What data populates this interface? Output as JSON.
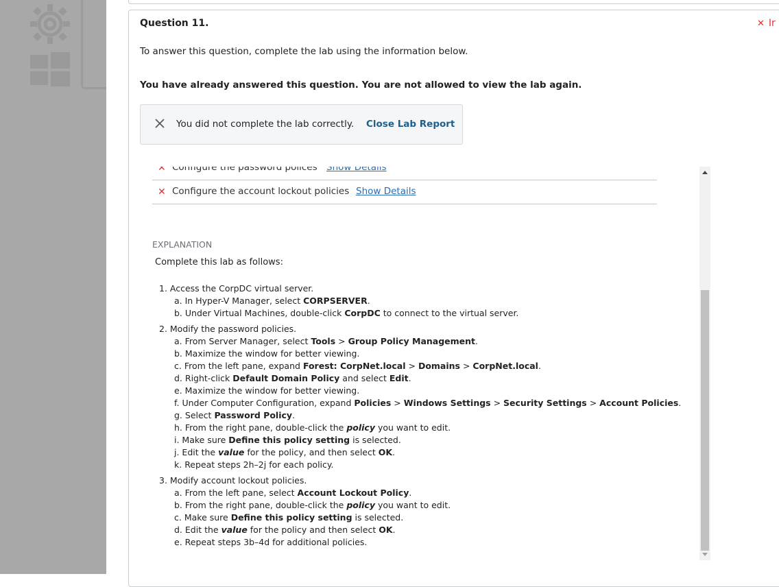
{
  "question": {
    "title": "Question 11.",
    "status_label": "Ir",
    "intro": "To answer this question, complete the lab using the information below.",
    "warning": "You have already answered this question. You are not allowed to view the lab again."
  },
  "report": {
    "message": "You did not complete the lab correctly.",
    "close_label": "Close Lab Report"
  },
  "results": [
    {
      "task": "Configure the password polices",
      "link": "Show Details"
    },
    {
      "task": "Configure the account lockout policies",
      "link": "Show Details"
    }
  ],
  "explanation": {
    "heading": "EXPLANATION",
    "intro": "Complete this lab as follows:",
    "steps": [
      {
        "num": "1.",
        "text": "Access the CorpDC virtual server.",
        "subs": [
          {
            "letter": "a.",
            "parts": [
              [
                "In Hyper-V Manager, select ",
                ""
              ],
              [
                "CORPSERVER",
                "b"
              ],
              [
                ".",
                ""
              ]
            ]
          },
          {
            "letter": "b.",
            "parts": [
              [
                "Under Virtual Machines, double-click ",
                ""
              ],
              [
                "CorpDC",
                "b"
              ],
              [
                " to connect to the virtual server.",
                ""
              ]
            ]
          }
        ]
      },
      {
        "num": "2.",
        "text": "Modify the password policies.",
        "subs": [
          {
            "letter": "a.",
            "parts": [
              [
                "From Server Manager, select ",
                ""
              ],
              [
                "Tools",
                "b"
              ],
              [
                " > ",
                ""
              ],
              [
                "Group Policy Management",
                "b"
              ],
              [
                ".",
                ""
              ]
            ]
          },
          {
            "letter": "b.",
            "parts": [
              [
                "Maximize the window for better viewing.",
                ""
              ]
            ]
          },
          {
            "letter": "c.",
            "parts": [
              [
                "From the left pane, expand ",
                ""
              ],
              [
                "Forest: CorpNet.local",
                "b"
              ],
              [
                " > ",
                ""
              ],
              [
                "Domains",
                "b"
              ],
              [
                " > ",
                ""
              ],
              [
                "CorpNet.local",
                "b"
              ],
              [
                ".",
                ""
              ]
            ]
          },
          {
            "letter": "d.",
            "parts": [
              [
                "Right-click ",
                ""
              ],
              [
                "Default Domain Policy",
                "b"
              ],
              [
                " and select ",
                ""
              ],
              [
                "Edit",
                "b"
              ],
              [
                ".",
                ""
              ]
            ]
          },
          {
            "letter": "e.",
            "parts": [
              [
                "Maximize the window for better viewing.",
                ""
              ]
            ]
          },
          {
            "letter": "f.",
            "parts": [
              [
                "Under Computer Configuration, expand ",
                ""
              ],
              [
                "Policies",
                "b"
              ],
              [
                " > ",
                ""
              ],
              [
                "Windows Settings",
                "b"
              ],
              [
                " > ",
                ""
              ],
              [
                "Security Settings",
                "b"
              ],
              [
                " > ",
                ""
              ],
              [
                "Account Policies",
                "b"
              ],
              [
                ".",
                ""
              ]
            ]
          },
          {
            "letter": "g.",
            "parts": [
              [
                "Select ",
                ""
              ],
              [
                "Password Policy",
                "b"
              ],
              [
                ".",
                ""
              ]
            ]
          },
          {
            "letter": "h.",
            "parts": [
              [
                "From the right pane, double-click the ",
                ""
              ],
              [
                "policy",
                "bi"
              ],
              [
                " you want to edit.",
                ""
              ]
            ]
          },
          {
            "letter": "i.",
            "parts": [
              [
                "Make sure ",
                ""
              ],
              [
                "Define this policy setting",
                "b"
              ],
              [
                " is selected.",
                ""
              ]
            ]
          },
          {
            "letter": "j.",
            "parts": [
              [
                "Edit the ",
                ""
              ],
              [
                "value",
                "bi"
              ],
              [
                " for the policy, and then select ",
                ""
              ],
              [
                "OK",
                "b"
              ],
              [
                ".",
                ""
              ]
            ]
          },
          {
            "letter": "k.",
            "parts": [
              [
                "Repeat steps 2h–2j for each policy.",
                ""
              ]
            ]
          }
        ]
      },
      {
        "num": "3.",
        "text": "Modify account lockout policies.",
        "subs": [
          {
            "letter": "a.",
            "parts": [
              [
                "From the left pane, select ",
                ""
              ],
              [
                "Account Lockout Policy",
                "b"
              ],
              [
                ".",
                ""
              ]
            ]
          },
          {
            "letter": "b.",
            "parts": [
              [
                "From the right pane, double-click the ",
                ""
              ],
              [
                "policy",
                "bi"
              ],
              [
                " you want to edit.",
                ""
              ]
            ]
          },
          {
            "letter": "c.",
            "parts": [
              [
                "Make sure ",
                ""
              ],
              [
                "Define this policy setting",
                "b"
              ],
              [
                " is selected.",
                ""
              ]
            ]
          },
          {
            "letter": "d.",
            "parts": [
              [
                "Edit the ",
                ""
              ],
              [
                "value",
                "bi"
              ],
              [
                " for the policy and then select ",
                ""
              ],
              [
                "OK",
                "b"
              ],
              [
                ".",
                ""
              ]
            ]
          },
          {
            "letter": "e.",
            "parts": [
              [
                "Repeat steps 3b–4d for additional policies.",
                ""
              ]
            ]
          }
        ]
      }
    ]
  },
  "colors": {
    "error": "#dd3333",
    "link": "#2a6db5",
    "close_link": "#1f5f8b",
    "backdrop": "#a8a8a8"
  },
  "icons": [
    "gear-icon",
    "windows-logo-icon",
    "close-icon",
    "x-mark-icon"
  ]
}
